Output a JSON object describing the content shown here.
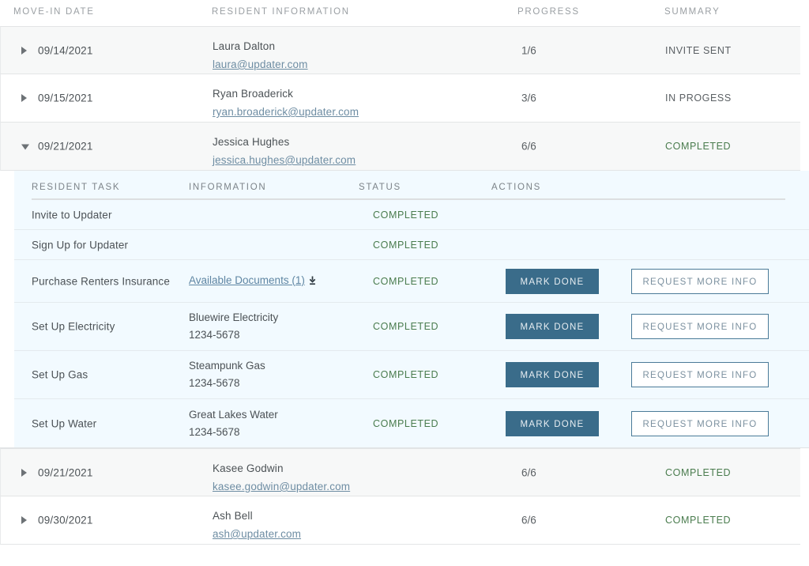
{
  "main_table": {
    "columns": [
      "MOVE-IN DATE",
      "RESIDENT INFORMATION",
      "PROGRESS",
      "SUMMARY"
    ],
    "rows": [
      {
        "expanded": false,
        "caret_icon": "triangle-right-icon",
        "date": "09/14/2021",
        "name": "Laura Dalton",
        "email": "laura@updater.com",
        "progress": "1/6",
        "summary": "INVITE SENT",
        "summary_state": "invite-sent"
      },
      {
        "expanded": false,
        "caret_icon": "triangle-right-icon",
        "date": "09/15/2021",
        "name": "Ryan Broaderick",
        "email": "ryan.broaderick@updater.com",
        "progress": "3/6",
        "summary": "IN PROGESS",
        "summary_state": "in-progress"
      },
      {
        "expanded": true,
        "caret_icon": "triangle-down-icon",
        "date": "09/21/2021",
        "name": "Jessica Hughes",
        "email": "jessica.hughes@updater.com",
        "progress": "6/6",
        "summary": "COMPLETED",
        "summary_state": "completed"
      },
      {
        "expanded": false,
        "caret_icon": "triangle-right-icon",
        "date": "09/21/2021",
        "name": "Kasee Godwin",
        "email": "kasee.godwin@updater.com",
        "progress": "6/6",
        "summary": "COMPLETED",
        "summary_state": "completed"
      },
      {
        "expanded": false,
        "caret_icon": "triangle-right-icon",
        "date": "09/30/2021",
        "name": "Ash Bell",
        "email": "ash@updater.com",
        "progress": "6/6",
        "summary": "COMPLETED",
        "summary_state": "completed"
      }
    ]
  },
  "sub_table": {
    "columns": [
      "RESIDENT TASK",
      "INFORMATION",
      "STATUS",
      "ACTIONS"
    ],
    "rows": [
      {
        "task": "Invite to Updater",
        "info_primary": "",
        "info_secondary": "",
        "doc_link": "",
        "status": "COMPLETED",
        "has_actions": false
      },
      {
        "task": "Sign Up for Updater",
        "info_primary": "",
        "info_secondary": "",
        "doc_link": "",
        "status": "COMPLETED",
        "has_actions": false
      },
      {
        "task": "Purchase Renters Insurance",
        "info_primary": "",
        "info_secondary": "",
        "doc_link": "Available Documents (1)",
        "doc_icon": "download-icon",
        "status": "COMPLETED",
        "has_actions": true
      },
      {
        "task": "Set Up Electricity",
        "info_primary": "Bluewire Electricity",
        "info_secondary": "1234-5678",
        "doc_link": "",
        "status": "COMPLETED",
        "has_actions": true
      },
      {
        "task": "Set Up Gas",
        "info_primary": "Steampunk Gas",
        "info_secondary": "1234-5678",
        "doc_link": "",
        "status": "COMPLETED",
        "has_actions": true
      },
      {
        "task": "Set Up Water",
        "info_primary": "Great Lakes Water",
        "info_secondary": "1234-5678",
        "doc_link": "",
        "status": "COMPLETED",
        "has_actions": true
      }
    ],
    "buttons": {
      "mark_done": "MARK DONE",
      "request_more_info": "REQUEST MORE INFO"
    }
  },
  "colors": {
    "primary_button": "#3a6c8a",
    "secondary_border": "#4b7b98",
    "completed_green": "#4a7c4e",
    "link_blue": "#6e8da3",
    "row_shaded": "#f7f8f8",
    "subpanel_bg": "#f2faff",
    "header_gray": "#9a9fa3"
  }
}
